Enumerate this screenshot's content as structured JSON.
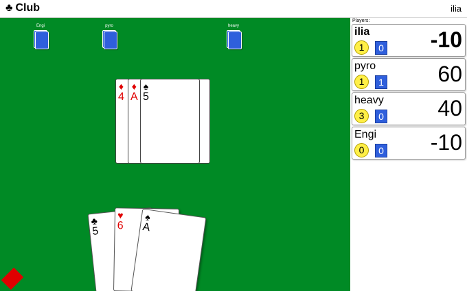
{
  "header": {
    "icon": "club-icon",
    "title": "Club",
    "username": "ilia"
  },
  "opponents": [
    {
      "name": "Engi"
    },
    {
      "name": "pyro"
    },
    {
      "name": "heavy"
    }
  ],
  "trick": [
    {
      "suit": "♦",
      "rank": "4",
      "color": "#e00000"
    },
    {
      "suit": "♦",
      "rank": "A",
      "color": "#e00000"
    },
    {
      "suit": "♠",
      "rank": "5",
      "color": "#000000"
    }
  ],
  "hand": [
    {
      "suit": "♣",
      "rank": "5",
      "color": "#000000"
    },
    {
      "suit": "♥",
      "rank": "6",
      "color": "#e00000"
    },
    {
      "suit": "♠",
      "rank": "A",
      "color": "#000000"
    }
  ],
  "trump": {
    "icon": "diamond-icon",
    "color": "#e00000"
  },
  "sidebar": {
    "label": "Players:",
    "players": [
      {
        "name": "ilia",
        "bid": "1",
        "tricks": "0",
        "score": "-10"
      },
      {
        "name": "pyro",
        "bid": "1",
        "tricks": "1",
        "score": "60"
      },
      {
        "name": "heavy",
        "bid": "3",
        "tricks": "0",
        "score": "40"
      },
      {
        "name": "Engi",
        "bid": "0",
        "tricks": "0",
        "score": "-10"
      }
    ]
  },
  "colors": {
    "table": "#008a25",
    "card_back": "#2f5fdc",
    "bid_badge": "#ffef47",
    "tricks_badge": "#2f5fdc"
  }
}
